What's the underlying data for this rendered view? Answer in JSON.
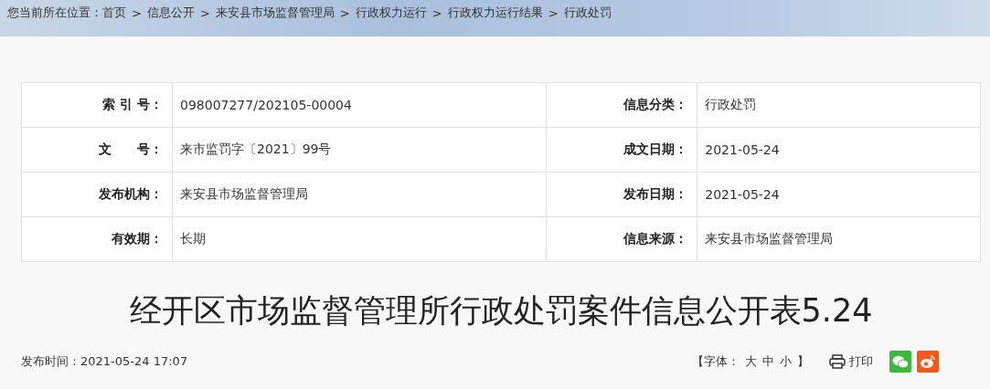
{
  "breadcrumb": {
    "prefix": "您当前所在位置：",
    "separator": ">",
    "items": [
      "首页",
      "信息公开",
      "来安县市场监督管理局",
      "行政权力运行",
      "行政权力运行结果",
      "行政处罚"
    ]
  },
  "info_table": [
    [
      {
        "label": "索 引 号：",
        "value": "098007277/202105-00004"
      },
      {
        "label": "信息分类：",
        "value": "行政处罚"
      }
    ],
    [
      {
        "label": "文　　号：",
        "value": "来市监罚字〔2021〕99号"
      },
      {
        "label": "成文日期：",
        "value": "2021-05-24"
      }
    ],
    [
      {
        "label": "发布机构：",
        "value": "来安县市场监督管理局"
      },
      {
        "label": "发布日期：",
        "value": "2021-05-24"
      }
    ],
    [
      {
        "label": "有效期：",
        "value": "长期"
      },
      {
        "label": "信息来源：",
        "value": "来安县市场监督管理局"
      }
    ]
  ],
  "title": "经开区市场监督管理所行政处罚案件信息公开表5.24",
  "publish_time": "发布时间：2021-05-24 17:07",
  "font_size": {
    "prefix": "【字体：",
    "options": [
      "大",
      "中",
      "小"
    ],
    "suffix": "】"
  },
  "print": "打印"
}
